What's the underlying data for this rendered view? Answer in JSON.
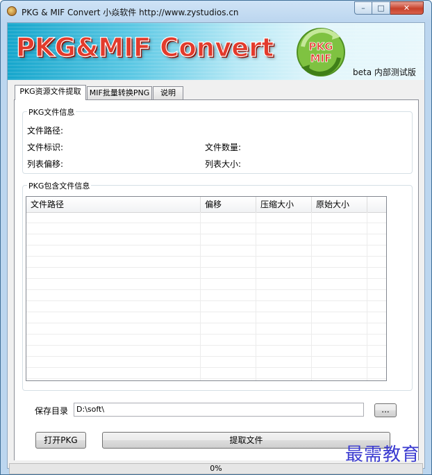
{
  "window": {
    "title": "PKG & MIF Convert 小焱软件 http://www.zystudios.cn",
    "minimize_glyph": "–",
    "maximize_glyph": "□",
    "close_glyph": "✕"
  },
  "banner": {
    "title": "PKG&MIF Convert",
    "logo_line1": "PKG",
    "logo_line2": "MIF",
    "beta": "beta 内部测试版"
  },
  "tabs": [
    {
      "label": "PKG资源文件提取",
      "active": true
    },
    {
      "label": "MIF批量转换PNG",
      "active": false
    },
    {
      "label": "说明",
      "active": false
    }
  ],
  "pkg_info": {
    "group_title": "PKG文件信息",
    "file_path_label": "文件路径:",
    "file_id_label": "文件标识:",
    "file_count_label": "文件数量:",
    "list_offset_label": "列表偏移:",
    "list_size_label": "列表大小:"
  },
  "pkg_contents": {
    "group_title": "PKG包含文件信息",
    "columns": [
      "文件路径",
      "偏移",
      "压缩大小",
      "原始大小"
    ],
    "rows": []
  },
  "save": {
    "label": "保存目录",
    "path": "D:\\soft\\",
    "browse_label": "..."
  },
  "buttons": {
    "open_pkg": "打开PKG",
    "extract": "提取文件"
  },
  "progress": {
    "percent": 0,
    "text": "0%"
  },
  "watermark": "最需教育",
  "colors": {
    "banner_title": "#e33b2c",
    "progress_fill": "#06b025",
    "watermark": "#3a3ad0"
  }
}
